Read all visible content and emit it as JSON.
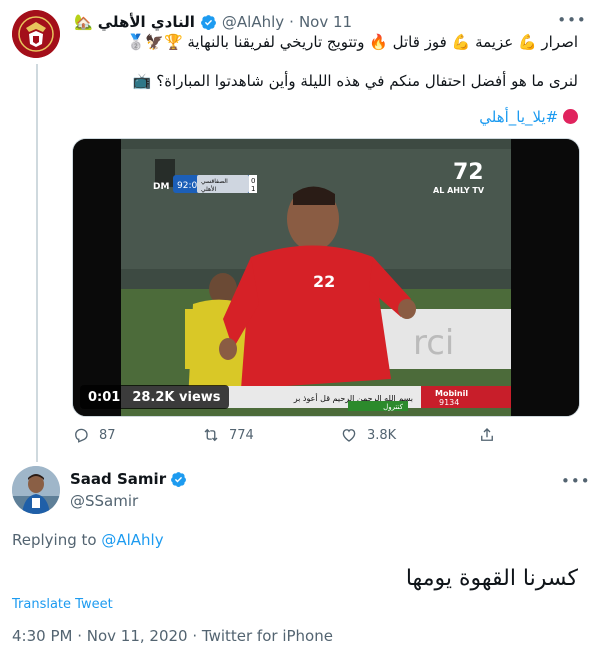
{
  "tweet": {
    "author": {
      "name": "النادي الأهلي",
      "name_emoji": "🏡",
      "handle": "@AlAhly",
      "avatar_icon": "al-ahly-club-crest"
    },
    "separator": "·",
    "date": "Nov 11",
    "text_line1": "اصرار 💪 عزيمة 💪 فوز قاتل 🔥 وتتويج تاريخي لفريقنا بالنهاية 🏆🦅🥈",
    "text_line2": "لنرى ما هو أفضل احتفال منكم في هذه الليلة وأين شاهدتوا المباراة؟ 📺",
    "hashtag": "#يلا_يا_أهلي",
    "media": {
      "time": "0:01",
      "views": "28.2K views",
      "scoreboard_clock": "92:04",
      "scoreboard_teams": [
        "الصفاقسي",
        "الأهلي"
      ],
      "scoreboard_scores": [
        "0",
        "1"
      ],
      "channel_number": "72",
      "channel_name": "AL AHLY TV",
      "player_number": "22",
      "ticker_text": "بسم الله الرحمن الرحيم قل أعوذ بر",
      "ticker_brand": "Mobinil",
      "ticker_number": "9134",
      "ticker_green": "كنترول",
      "corner_logo": "DM"
    },
    "actions": {
      "replies": "87",
      "retweets": "774",
      "likes": "3.8K"
    }
  },
  "reply": {
    "author": {
      "name": "Saad Samir",
      "handle": "@SSamir"
    },
    "replying_label": "Replying to",
    "replying_to": "@AlAhly",
    "text": "كسرنا القهوة يومها",
    "translate_label": "Translate Tweet",
    "timestamp": "4:30 PM · Nov 11, 2020 · Twitter for iPhone"
  },
  "colors": {
    "accent": "#1d9bf0",
    "secondary_text": "#536471",
    "primary_text": "#0f1419",
    "thread_line": "#cfd9de",
    "ahly_red": "#b3121f"
  }
}
